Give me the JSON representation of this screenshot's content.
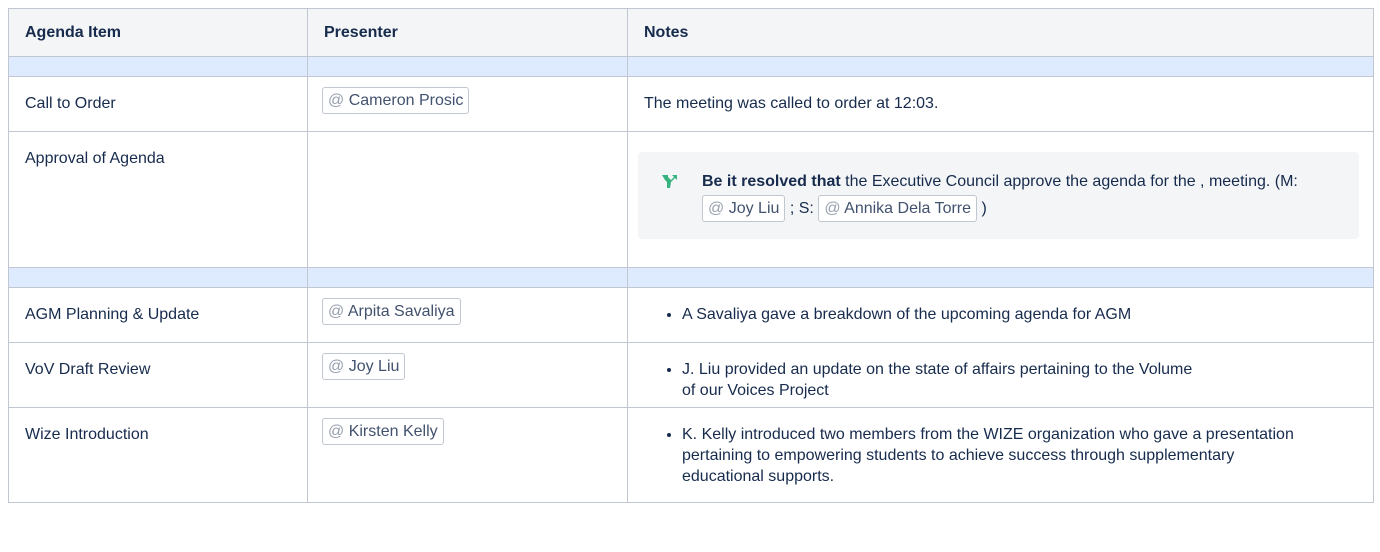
{
  "headers": {
    "agenda_item": "Agenda Item",
    "presenter": "Presenter",
    "notes": "Notes"
  },
  "rows": {
    "call_to_order": {
      "item": "Call to Order",
      "presenter": "Cameron Prosic",
      "notes": "The meeting was called to order at 12:03."
    },
    "approval": {
      "item": "Approval of Agenda",
      "decision": {
        "bold": "Be it resolved that",
        "text1": "the Executive Council approve the agenda for the , meeting. (M:",
        "mover": "Joy Liu",
        "text2": "; S:",
        "seconder": "Annika Dela Torre",
        "text3": ")"
      }
    },
    "agm": {
      "item": "AGM Planning & Update",
      "presenter": "Arpita Savaliya",
      "note": "A Savaliya gave a breakdown of the upcoming agenda for AGM"
    },
    "vov": {
      "item": "VoV Draft Review",
      "presenter": "Joy Liu",
      "note": "J. Liu provided an update on the state of affairs pertaining to the Volume of our Voices Project"
    },
    "wize": {
      "item": "Wize Introduction",
      "presenter": "Kirsten Kelly",
      "note": "K. Kelly introduced two members from the WIZE organization who gave a presentation pertaining to empowering students to achieve success through supplementary educational supports."
    }
  },
  "mention_prefix": "@",
  "colors": {
    "header_bg": "#f4f5f7",
    "separator_bg": "#deebff",
    "decision_icon": "#36b37e",
    "border": "#c1c7d0"
  },
  "icons": {
    "decision": "decision-icon"
  }
}
